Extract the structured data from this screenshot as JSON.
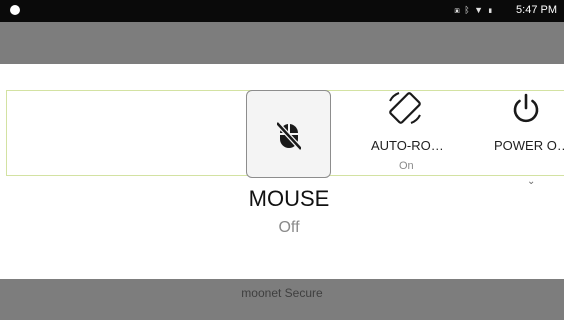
{
  "status_bar": {
    "time": "5:47 PM",
    "icons": [
      "screenshot-icon",
      "bluetooth-icon",
      "wifi-icon",
      "battery-icon"
    ]
  },
  "tiles": [
    {
      "id": "mouse",
      "icon": "mouse-off-icon",
      "selected": true
    },
    {
      "id": "auto-rotate",
      "icon": "auto-rotate-icon",
      "label": "AUTO-RO…",
      "sub": "On"
    },
    {
      "id": "power",
      "icon": "power-icon",
      "label": "POWER O…"
    }
  ],
  "detail": {
    "label": "MOUSE",
    "sub": "Off"
  },
  "footer": {
    "text": "moonet Secure"
  },
  "colors": {
    "status_bar_bg": "#0a0a0a",
    "overlay_band": "#7d7d7d",
    "tile_strip_border": "#d3e2a2",
    "selected_tile_bg": "#f4f4f4"
  }
}
